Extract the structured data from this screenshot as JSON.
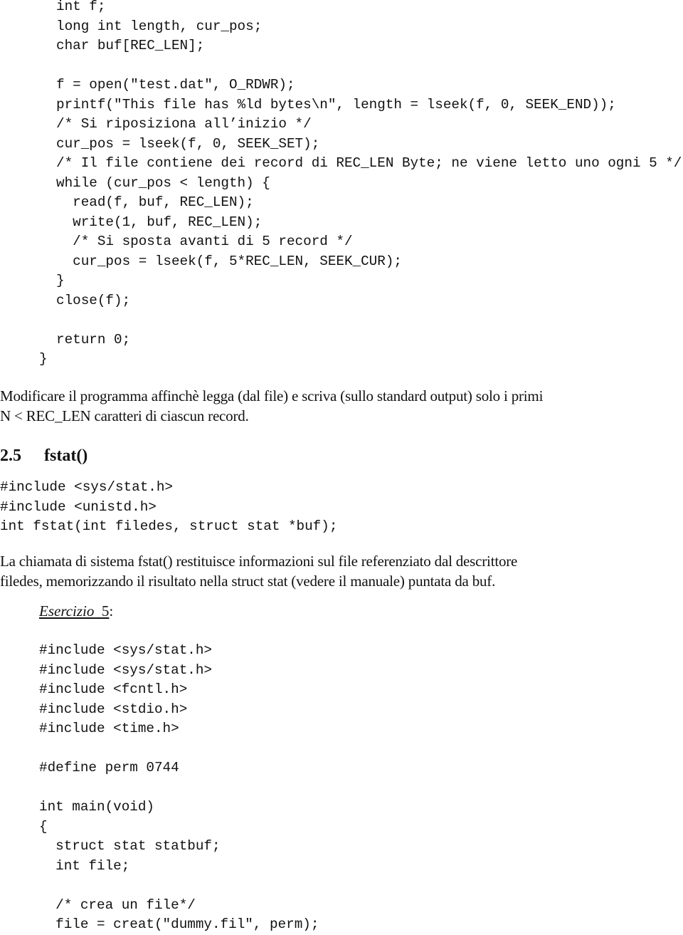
{
  "code_block_1": {
    "lines": [
      "int f;",
      "long int length, cur_pos;",
      "char buf[REC_LEN];",
      "",
      "f = open(\"test.dat\", O_RDWR);",
      "printf(\"This file has %ld bytes\\n\", length = lseek(f, 0, SEEK_END));",
      "/* Si riposiziona all’inizio */",
      "cur_pos = lseek(f, 0, SEEK_SET);",
      "/* Il file contiene dei record di REC_LEN Byte; ne viene letto uno ogni 5 */",
      "while (cur_pos < length) {",
      "  read(f, buf, REC_LEN);",
      "  write(1, buf, REC_LEN);",
      "  /* Si sposta avanti di 5 record */",
      "  cur_pos = lseek(f, 5*REC_LEN, SEEK_CUR);",
      "}",
      "close(f);",
      "",
      "return 0;"
    ],
    "closing_brace": "}"
  },
  "paragraph_1": {
    "lines": [
      "Modificare il programma affinchè legga (dal file) e scriva (sullo standard output) solo i primi",
      "N < REC_LEN caratteri di ciascun record."
    ]
  },
  "section": {
    "number": "2.5",
    "title": "fstat()"
  },
  "code_block_2": {
    "lines": [
      "#include <sys/stat.h>",
      "#include <unistd.h>",
      "int fstat(int filedes, struct stat *buf);"
    ]
  },
  "paragraph_2": {
    "lines": [
      "La chiamata di sistema fstat() restituisce informazioni sul file referenziato dal descrittore",
      "filedes, memorizzando il risultato nella struct stat (vedere il manuale) puntata da buf."
    ]
  },
  "exercise": {
    "label": "Esercizio",
    "number": "5",
    "suffix": ":"
  },
  "code_block_3": {
    "lines": [
      "#include <sys/stat.h>",
      "#include <sys/stat.h>",
      "#include <fcntl.h>",
      "#include <stdio.h>",
      "#include <time.h>",
      "",
      "#define perm 0744",
      "",
      "int main(void)",
      "{",
      "  struct stat statbuf;",
      "  int file;",
      "",
      "  /* crea un file*/",
      "  file = creat(\"dummy.fil\", perm);"
    ]
  }
}
